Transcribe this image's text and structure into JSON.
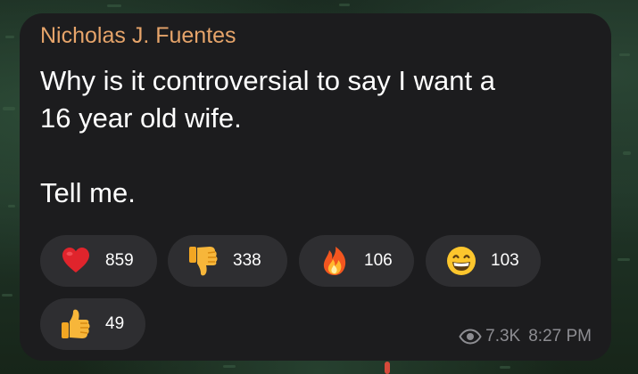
{
  "message": {
    "sender_name": "Nicholas J. Fuentes",
    "text_line_1": "Why is it controversial to say I want a",
    "text_line_2": "16 year old wife.",
    "text_line_3": "Tell me."
  },
  "reactions": [
    {
      "icon": "red-heart-icon",
      "count": "859"
    },
    {
      "icon": "thumbs-down-icon",
      "count": "338"
    },
    {
      "icon": "fire-icon",
      "count": "106"
    },
    {
      "icon": "grinning-face-icon",
      "count": "103"
    },
    {
      "icon": "thumbs-up-icon",
      "count": "49"
    }
  ],
  "meta": {
    "views": "7.3K",
    "time": "8:27 PM"
  },
  "colors": {
    "sender_name": "#e6a46a",
    "bubble": "#1c1c1e",
    "reaction_pill": "#2e2e31",
    "meta_text": "#8d8d92"
  }
}
